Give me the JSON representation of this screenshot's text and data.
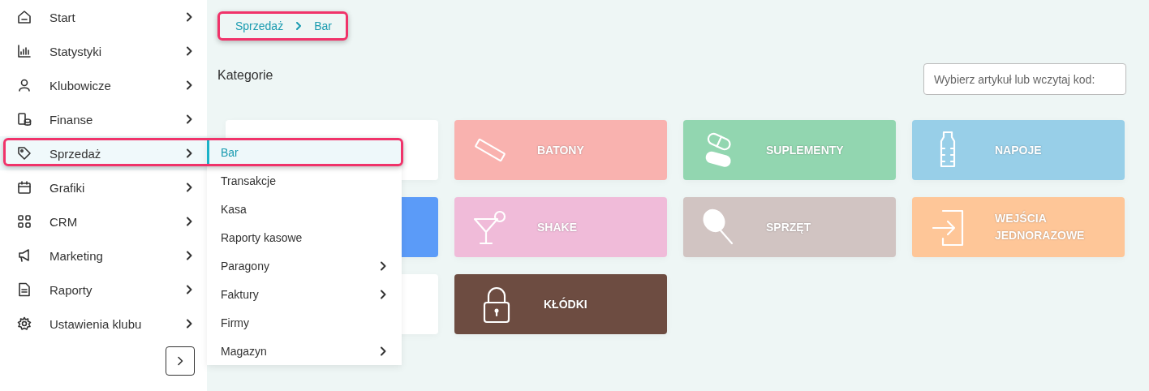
{
  "sidebar": {
    "items": [
      {
        "label": "Start",
        "selected": false,
        "highlighted": false
      },
      {
        "label": "Statystyki",
        "selected": false,
        "highlighted": false
      },
      {
        "label": "Klubowicze",
        "selected": false,
        "highlighted": false
      },
      {
        "label": "Finanse",
        "selected": false,
        "highlighted": false
      },
      {
        "label": "Sprzedaż",
        "selected": true,
        "highlighted": true
      },
      {
        "label": "Grafiki",
        "selected": false,
        "highlighted": false
      },
      {
        "label": "CRM",
        "selected": false,
        "highlighted": false
      },
      {
        "label": "Marketing",
        "selected": false,
        "highlighted": false
      },
      {
        "label": "Raporty",
        "selected": false,
        "highlighted": false
      },
      {
        "label": "Ustawienia klubu",
        "selected": false,
        "highlighted": false
      }
    ]
  },
  "submenu": {
    "items": [
      {
        "label": "Bar",
        "selected": true,
        "has_children": false
      },
      {
        "label": "Transakcje",
        "selected": false,
        "has_children": false
      },
      {
        "label": "Kasa",
        "selected": false,
        "has_children": false
      },
      {
        "label": "Raporty kasowe",
        "selected": false,
        "has_children": false
      },
      {
        "label": "Paragony",
        "selected": false,
        "has_children": true
      },
      {
        "label": "Faktury",
        "selected": false,
        "has_children": true
      },
      {
        "label": "Firmy",
        "selected": false,
        "has_children": false
      },
      {
        "label": "Magazyn",
        "selected": false,
        "has_children": true
      }
    ]
  },
  "breadcrumb": {
    "highlighted": true,
    "items": [
      "Sprzedaż",
      "Bar"
    ]
  },
  "heading": "Kategorie",
  "search": {
    "placeholder": "Wybierz artykuł lub wczytaj kod:"
  },
  "categories": [
    {
      "color": "#ffffff"
    },
    {
      "label": "BATONY",
      "color": "#f9b2af"
    },
    {
      "label": "SUPLEMENTY",
      "color": "#92d6b0"
    },
    {
      "label": "NAPOJE",
      "color": "#98cfe8"
    },
    {
      "color": "#5b9bf8"
    },
    {
      "label": "SHAKE",
      "color": "#f0bbd9"
    },
    {
      "label": "SPRZĘT",
      "color": "#d1c4c2"
    },
    {
      "label": "WEJŚCIA JEDNORAZOWE",
      "color": "#fec698"
    },
    {
      "color": "#ffffff"
    },
    {
      "label": "KŁÓDKI",
      "color": "#6d4c41"
    }
  ]
}
